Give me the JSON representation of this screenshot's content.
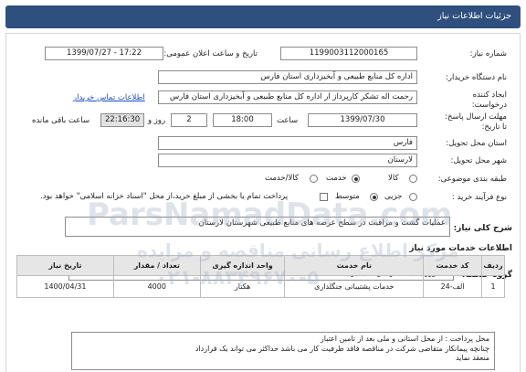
{
  "header": {
    "title": "جزئیات اطلاعات نیاز"
  },
  "form": {
    "need_number_label": "شماره نیاز:",
    "need_number": "1199003112000165",
    "announce_label": "تاریخ و ساعت اعلان عمومی:",
    "announce_value": "1399/07/27 - 17:22",
    "buyer_label": "نام دستگاه خریدار:",
    "buyer_value": "اداره کل منابع طبیعی و آبخیزداری استان فارس",
    "creator_label": "ایجاد کننده درخواست:",
    "creator_value": "رحمت اله تشکر کارپرداز ار اداره کل منابع طبیعی و آبخیزداری استان فارس",
    "contact_link": "اطلاعات تماس خریدار",
    "deadline_label": "مهلت ارسال پاسخ:",
    "deadline_label2": "تا تاریخ:",
    "deadline_date": "1399/07/30",
    "time_label": "ساعت",
    "deadline_time": "18:00",
    "days_value": "2",
    "days_label": "روز و",
    "remaining_time": "22:16:30",
    "remaining_label": "ساعت باقی مانده",
    "province_label": "استان محل تحویل:",
    "province_value": "فارس",
    "city_label": "شهر محل تحویل:",
    "city_value": "لارستان",
    "category_label": "طبقه بندی موضوعی:",
    "category_options": [
      "کالا",
      "خدمت",
      "کالا/خدمت"
    ],
    "category_selected": "خدمت",
    "process_label": "نوع فرآیند خرید :",
    "process_options": [
      "جزیی",
      "متوسط"
    ],
    "process_selected": "متوسط",
    "payment_note": "پرداخت تمام یا بخشی از مبلغ خرید،از محل \"اسناد خزانه اسلامی\" خواهد بود."
  },
  "description": {
    "label": "شرح کلی نیاز:",
    "value": "عملیات گشت و مراقبت در سطح عرصه های منابع طبیعی شهرستان لارستان"
  },
  "services_section": {
    "title": "اطلاعات خدمات مورد نیاز",
    "group_label": "گروه خدمت:",
    "group_value": "کشاورزی، جنگلداری و ماهیگیری"
  },
  "table": {
    "headers": [
      "ردیف",
      "کد خدمت",
      "نام خدمت",
      "واحد اندازه گیری",
      "تعداد / مقدار",
      "تاریخ نیاز"
    ],
    "rows": [
      {
        "row": "1",
        "code": "الف-24",
        "name": "خدمات پشتیبانی جنگلداری",
        "unit": "هکتار",
        "qty": "4000",
        "date": "1400/04/31"
      }
    ]
  },
  "notes": {
    "lines": [
      "محل پرداخت : از محل استانی و ملی بعد از تامین اعتبار",
      "چنانچه پیمانکار متقاضی شرکت در مناقصه فاقد ظرفیت کار می باشد حداکثر می تواند یک قرارداد",
      "منعقد نماید",
      "............."
    ]
  },
  "watermark": {
    "line1": "ParsNamadData.com",
    "line2": "مرکز اطلاع رسانی مناقصه و مزایده",
    "line3": "۰۲۱-۸۸۳۴۹۶۷۰-۵"
  }
}
